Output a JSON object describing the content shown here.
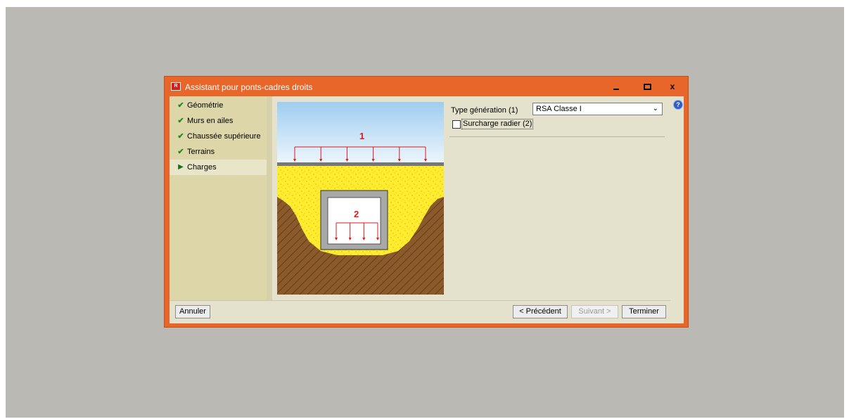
{
  "window": {
    "title": "Assistant pour ponts-cadres droits",
    "app_icon_text": "R",
    "controls": [
      "minimize-icon",
      "maximize-icon",
      "close-icon"
    ],
    "close_glyph": "x"
  },
  "nav": {
    "items": [
      {
        "label": "Géométrie",
        "state": "done",
        "mark": "✔"
      },
      {
        "label": "Murs en ailes",
        "state": "done",
        "mark": "✔"
      },
      {
        "label": "Chaussée supérieure",
        "state": "done",
        "mark": "✔"
      },
      {
        "label": "Terrains",
        "state": "done",
        "mark": "✔"
      },
      {
        "label": "Charges",
        "state": "current",
        "mark": "▶"
      }
    ]
  },
  "illustration": {
    "load_label_1": "1",
    "load_label_2": "2",
    "colors": {
      "sky_top": "#9ecdf0",
      "sky_bottom": "#eef6fc",
      "fill": "#ffec2e",
      "soil": "#8a5a2b",
      "load": "#e0191c",
      "concrete": "#a8a8a8"
    }
  },
  "form": {
    "type_label": "Type génération (1)",
    "type_value": "RSA Classe I",
    "surcharge_label": "Surcharge radier (2)",
    "surcharge_checked": false
  },
  "help_glyph": "?",
  "buttons": {
    "cancel": "Annuler",
    "previous": "< Précédent",
    "next": "Suivant >",
    "finish": "Terminer"
  },
  "colors": {
    "frame": "#e8662a",
    "nav_bg": "#ddd6a8",
    "content_bg": "#e4e2cc",
    "desktop": "#bbb9b4"
  }
}
